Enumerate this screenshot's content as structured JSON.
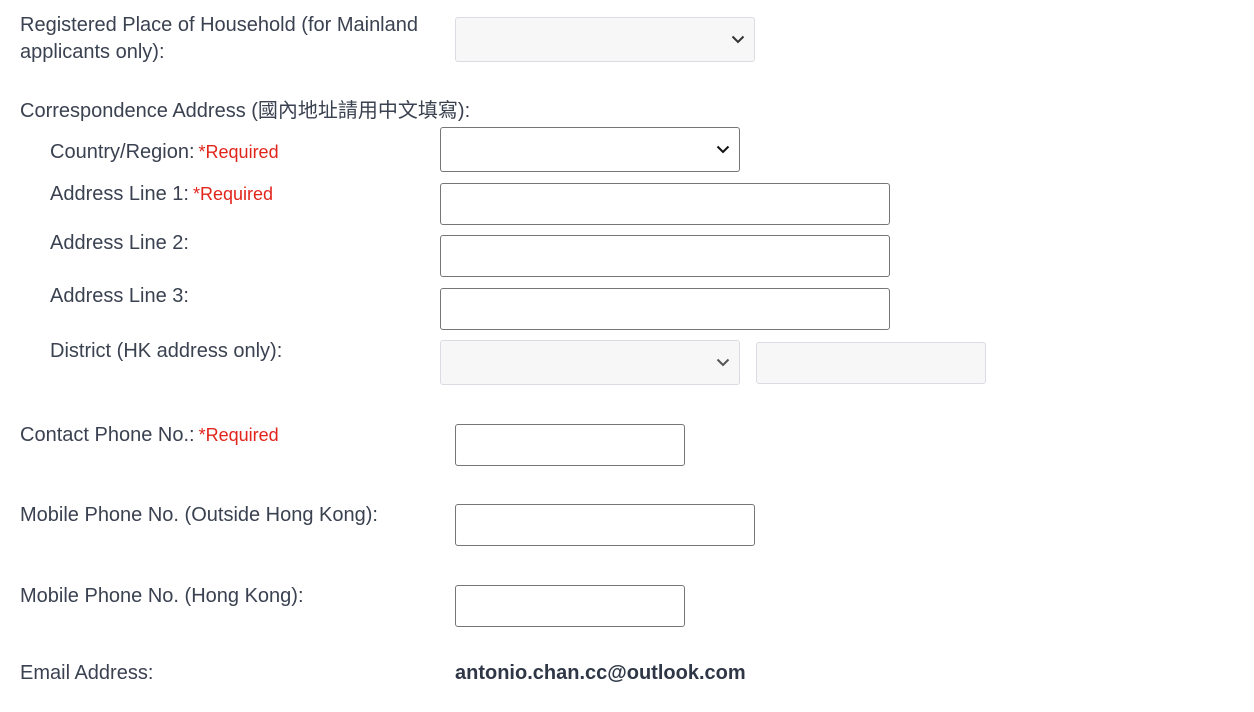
{
  "form": {
    "registered_place": {
      "label": "Registered Place of Household (for Mainland applicants only):",
      "selected_value": ""
    },
    "correspondence_address": {
      "label": "Correspondence Address (國內地址請用中文填寫):",
      "country": {
        "label": "Country/Region:",
        "required": "*Required",
        "selected_value": ""
      },
      "line1": {
        "label": "Address Line 1:",
        "required": "*Required",
        "value": ""
      },
      "line2": {
        "label": "Address Line 2:",
        "value": ""
      },
      "line3": {
        "label": "Address Line 3:",
        "value": ""
      },
      "district": {
        "label": "District (HK address only):",
        "selected_value": "",
        "extra_value": ""
      }
    },
    "contact_phone": {
      "label": "Contact Phone No.:",
      "required": "*Required",
      "value": ""
    },
    "mobile_outside_hk": {
      "label": "Mobile Phone No. (Outside Hong Kong):",
      "value": ""
    },
    "mobile_hk": {
      "label": "Mobile Phone No. (Hong Kong):",
      "value": ""
    },
    "email": {
      "label": "Email Address:",
      "value": "antonio.chan.cc@outlook.com"
    }
  },
  "colors": {
    "label_text": "#3a4150",
    "required_text": "#e1251b",
    "input_border": "#767676",
    "disabled_border": "#d9dde2",
    "disabled_bg": "#f7f7f7"
  },
  "icons": {
    "dropdown": "chevron-down-icon"
  }
}
